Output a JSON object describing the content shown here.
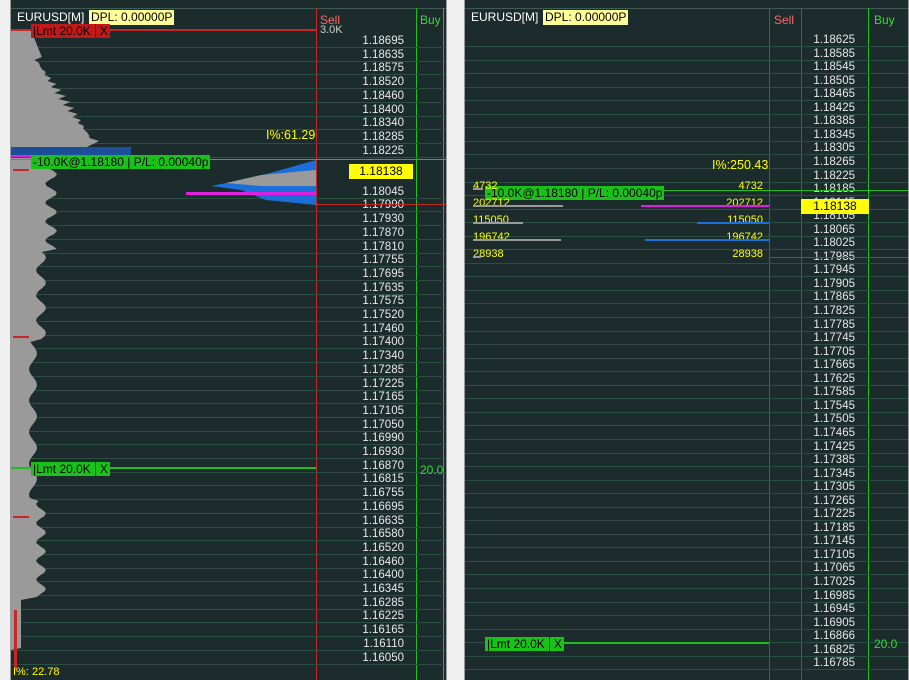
{
  "left": {
    "symbol": "EURUSD[M]",
    "dpl": "DPL: 0.00000P",
    "sell_label": "Sell",
    "buy_label": "Buy",
    "sell_volume_partial": "3.0K",
    "prices": [
      "1.18695",
      "1.18635",
      "1.18575",
      "1.18520",
      "1.18460",
      "1.18400",
      "1.18340",
      "1.18285",
      "1.18225",
      "1.18045",
      "1.17990",
      "1.17930",
      "1.17870",
      "1.17810",
      "1.17755",
      "1.17695",
      "1.17635",
      "1.17575",
      "1.17520",
      "1.17460",
      "1.17400",
      "1.17340",
      "1.17285",
      "1.17225",
      "1.17165",
      "1.17105",
      "1.17050",
      "1.16990",
      "1.16930",
      "1.16870",
      "1.16815",
      "1.16755",
      "1.16695",
      "1.16635",
      "1.16580",
      "1.16520",
      "1.16460",
      "1.16400",
      "1.16345",
      "1.16285",
      "1.16225",
      "1.16165",
      "1.16110",
      "1.16050"
    ],
    "current_price": "1.18138",
    "imbalance": "I%:61.29",
    "imbalance_bottom": "I%: 22.78",
    "position_tag": "-10.0K@1.18180 | P/L: 0.00040p",
    "limit_top": {
      "label": "|Lmt  20.0K",
      "close": "X"
    },
    "limit_mid": {
      "label": "|Lmt  20.0K",
      "close": "X"
    },
    "buy_volume_partial": "20.0"
  },
  "right": {
    "symbol": "EURUSD[M]",
    "dpl": "DPL: 0.00000P",
    "sell_label": "Sell",
    "buy_label": "Buy",
    "prices": [
      "1.18625",
      "1.18585",
      "1.18545",
      "1.18505",
      "1.18465",
      "1.18425",
      "1.18385",
      "1.18345",
      "1.18305",
      "1.18265",
      "1.18225",
      "1.18185",
      "1.18145",
      "1.18105",
      "1.18065",
      "1.18025",
      "1.17985",
      "1.17945",
      "1.17905",
      "1.17865",
      "1.17825",
      "1.17785",
      "1.17745",
      "1.17705",
      "1.17665",
      "1.17625",
      "1.17585",
      "1.17545",
      "1.17505",
      "1.17465",
      "1.17425",
      "1.17385",
      "1.17345",
      "1.17305",
      "1.17265",
      "1.17225",
      "1.17185",
      "1.17145",
      "1.17105",
      "1.17065",
      "1.17025",
      "1.16985",
      "1.16945",
      "1.16905",
      "1.16866",
      "1.16825",
      "1.16785"
    ],
    "current_price": "1.18138",
    "imbalance": "I%:250.43",
    "position_tag": "-10.0K@1.18180 | P/L: 0.00040p",
    "limit_bottom": {
      "label": "|Lmt  20.0K",
      "close": "X"
    },
    "buy_volume_partial": "20.0",
    "left_volumes": [
      "4732",
      "202712",
      "115050",
      "196742",
      "28938"
    ],
    "right_volumes": [
      "4732",
      "202712",
      "115050",
      "196742",
      "28938"
    ]
  },
  "colors": {
    "sell_line": "#c62828",
    "buy_line": "#1fbf1f",
    "grid": "#2c4f44",
    "background": "#1c2b2b",
    "highlight": "#ffff00",
    "magenta": "#e020e0",
    "blue": "#1c6fd8"
  }
}
